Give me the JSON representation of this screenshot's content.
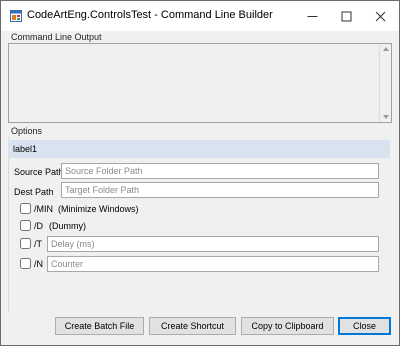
{
  "window": {
    "title": "CodeArtEng.ControlsTest - Command Line Builder",
    "caption_buttons": {
      "minimize": "—",
      "maximize": "☐",
      "close": "✕"
    }
  },
  "output": {
    "label": "Command Line Output",
    "value": ""
  },
  "options": {
    "label": "Options",
    "info_label": "label1",
    "source_path": {
      "label": "Source Path",
      "placeholder": "Source Folder Path",
      "value": ""
    },
    "dest_path": {
      "label": "Dest Path",
      "placeholder": "Target Folder Path",
      "value": ""
    },
    "flags": [
      {
        "switch": "/MIN",
        "description": "(Minimize Windows)",
        "checked": false
      },
      {
        "switch": "/D",
        "description": "(Dummy)",
        "checked": false
      },
      {
        "switch": "/T",
        "placeholder": "Delay (ms)",
        "value": "",
        "checked": false
      },
      {
        "switch": "/N",
        "placeholder": "Counter",
        "value": "",
        "checked": false
      }
    ]
  },
  "buttons": {
    "create_batch": "Create Batch File",
    "create_shortcut": "Create Shortcut",
    "copy_clipboard": "Copy to Clipboard",
    "close": "Close"
  },
  "colors": {
    "title_bg": "#ffffff",
    "window_bg": "#f0f0f0",
    "info_bar": "#d9e3f0",
    "default_button_border": "#0078d7"
  },
  "icons": {
    "app": "app-form-icon",
    "minimize": "minimize-icon",
    "maximize": "maximize-icon",
    "close": "close-icon"
  }
}
